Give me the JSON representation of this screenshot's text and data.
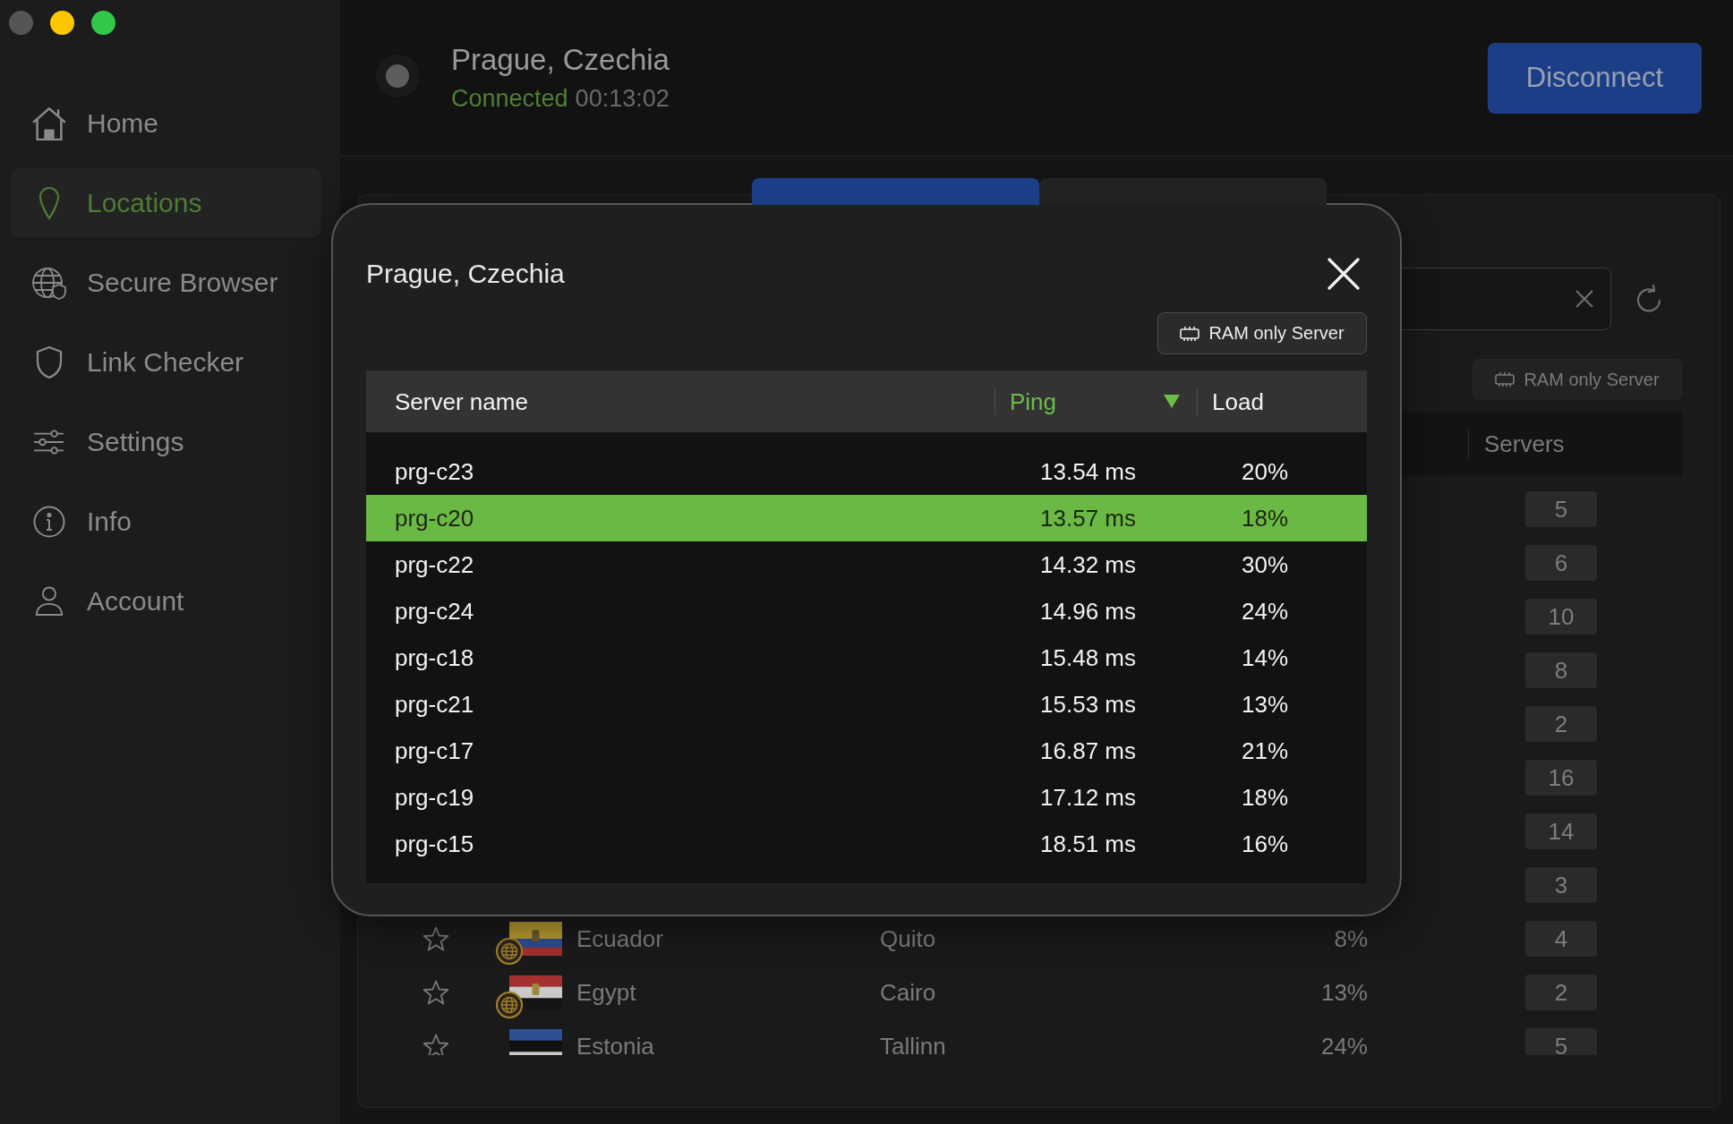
{
  "window_controls": [
    {
      "disabled": true
    },
    {
      "disabled": false
    },
    {
      "disabled": false
    }
  ],
  "sidebar": {
    "items": [
      {
        "label": "Home",
        "selected": false
      },
      {
        "label": "Locations",
        "selected": true
      },
      {
        "label": "Secure Browser",
        "selected": false
      },
      {
        "label": "Link Checker",
        "selected": false
      },
      {
        "label": "Settings",
        "selected": false
      },
      {
        "label": "Info",
        "selected": false
      },
      {
        "label": "Account",
        "selected": false
      }
    ]
  },
  "connection": {
    "location": "Prague, Czechia",
    "status": "Connected",
    "duration": "00:13:02"
  },
  "disconnect_button": {
    "label": "Disconnect"
  },
  "tabs": [
    {
      "selected": true
    },
    {
      "selected": false
    }
  ],
  "ram_filter_button": {
    "label": "RAM only Server"
  },
  "location_list": {
    "columns": [
      {
        "label": "Servers"
      }
    ],
    "rows": [
      {
        "servers": "5"
      },
      {
        "servers": "6"
      },
      {
        "servers": "10"
      },
      {
        "servers": "8"
      },
      {
        "servers": "2"
      },
      {
        "servers": "16"
      },
      {
        "servers": "14"
      },
      {
        "servers": "3"
      },
      {
        "favorite": false,
        "virtual": true,
        "country": "Ecuador",
        "city": "Quito",
        "load": "8%",
        "servers": "4"
      },
      {
        "favorite": false,
        "virtual": true,
        "country": "Egypt",
        "city": "Cairo",
        "load": "13%",
        "servers": "2"
      },
      {
        "favorite": false,
        "virtual": false,
        "country": "Estonia",
        "city": "Tallinn",
        "load": "24%",
        "servers": "5"
      }
    ]
  },
  "server_dialog": {
    "title": "Prague, Czechia",
    "ram_filter_button": {
      "label": "RAM only Server"
    },
    "columns": [
      {
        "label": "Server name",
        "sorted": false
      },
      {
        "label": "Ping",
        "sorted": true
      },
      {
        "label": "Load",
        "sorted": false
      }
    ],
    "rows": [
      {
        "name": "prg-c23",
        "ping": "13.54 ms",
        "load": "20%",
        "selected": false
      },
      {
        "name": "prg-c20",
        "ping": "13.57 ms",
        "load": "18%",
        "selected": true
      },
      {
        "name": "prg-c22",
        "ping": "14.32 ms",
        "load": "30%",
        "selected": false
      },
      {
        "name": "prg-c24",
        "ping": "14.96 ms",
        "load": "24%",
        "selected": false
      },
      {
        "name": "prg-c18",
        "ping": "15.48 ms",
        "load": "14%",
        "selected": false
      },
      {
        "name": "prg-c21",
        "ping": "15.53 ms",
        "load": "13%",
        "selected": false
      },
      {
        "name": "prg-c17",
        "ping": "16.87 ms",
        "load": "21%",
        "selected": false
      },
      {
        "name": "prg-c19",
        "ping": "17.12 ms",
        "load": "18%",
        "selected": false
      },
      {
        "name": "prg-c15",
        "ping": "18.51 ms",
        "load": "16%",
        "selected": false
      }
    ]
  }
}
